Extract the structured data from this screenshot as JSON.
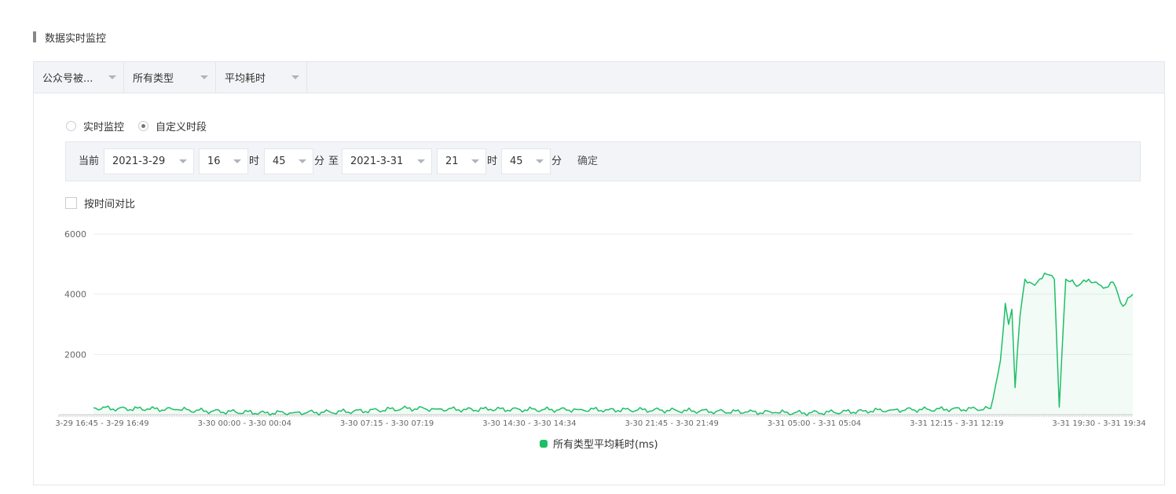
{
  "section_title": "数据实时监控",
  "filters": [
    {
      "label": "公众号被..."
    },
    {
      "label": "所有类型"
    },
    {
      "label": "平均耗时"
    }
  ],
  "mode": {
    "options": [
      {
        "label": "实时监控",
        "checked": false
      },
      {
        "label": "自定义时段",
        "checked": true
      }
    ]
  },
  "range": {
    "current_label": "当前",
    "start_date": "2021-3-29",
    "start_hour": "16",
    "hour_unit": "时",
    "start_minute": "45",
    "minute_unit": "分",
    "to_label": "至",
    "end_date": "2021-3-31",
    "end_hour": "21",
    "end_minute": "45",
    "confirm_label": "确定"
  },
  "compare": {
    "label": "按时间对比",
    "checked": false
  },
  "colors": {
    "series": "#1dbf66",
    "grid": "#eeeeee",
    "axis_text": "#666666"
  },
  "chart_data": {
    "type": "area",
    "ylim": [
      0,
      6000
    ],
    "yticks": [
      "6000",
      "4000",
      "2000"
    ],
    "x_ticks": [
      "3-29 16:45 - 3-29 16:49",
      "3-30 00:00 - 3-30 00:04",
      "3-30 07:15 - 3-30 07:19",
      "3-30 14:30 - 3-30 14:34",
      "3-30 21:45 - 3-30 21:49",
      "3-31 05:00 - 3-31 05:04",
      "3-31 12:15 - 3-31 12:19",
      "3-31 19:30 - 3-31 19:34"
    ],
    "series": [
      {
        "name": "所有类型平均耗时(ms)",
        "points": [
          [
            "3-29 16:45",
            230
          ],
          [
            "3-29 18:00",
            200
          ],
          [
            "3-29 19:30",
            190
          ],
          [
            "3-29 21:00",
            170
          ],
          [
            "3-29 22:30",
            120
          ],
          [
            "3-30 00:00",
            90
          ],
          [
            "3-30 01:30",
            60
          ],
          [
            "3-30 03:00",
            70
          ],
          [
            "3-30 04:30",
            80
          ],
          [
            "3-30 06:00",
            110
          ],
          [
            "3-30 07:15",
            150
          ],
          [
            "3-30 08:45",
            210
          ],
          [
            "3-30 10:15",
            190
          ],
          [
            "3-30 11:45",
            170
          ],
          [
            "3-30 13:00",
            180
          ],
          [
            "3-30 14:30",
            170
          ],
          [
            "3-30 16:00",
            165
          ],
          [
            "3-30 17:30",
            170
          ],
          [
            "3-30 19:00",
            160
          ],
          [
            "3-30 20:30",
            155
          ],
          [
            "3-30 21:45",
            150
          ],
          [
            "3-30 23:00",
            130
          ],
          [
            "3-31 00:30",
            110
          ],
          [
            "3-31 02:00",
            90
          ],
          [
            "3-31 03:30",
            70
          ],
          [
            "3-31 05:00",
            60
          ],
          [
            "3-31 06:30",
            80
          ],
          [
            "3-31 08:00",
            120
          ],
          [
            "3-31 09:30",
            160
          ],
          [
            "3-31 11:00",
            170
          ],
          [
            "3-31 12:15",
            180
          ],
          [
            "3-31 13:45",
            190
          ],
          [
            "3-31 14:30",
            200
          ],
          [
            "3-31 15:00",
            1800
          ],
          [
            "3-31 15:10",
            3000
          ],
          [
            "3-31 15:15",
            3700
          ],
          [
            "3-31 15:25",
            3000
          ],
          [
            "3-31 15:35",
            3500
          ],
          [
            "3-31 15:45",
            900
          ],
          [
            "3-31 16:00",
            3300
          ],
          [
            "3-31 16:15",
            4500
          ],
          [
            "3-31 16:45",
            4300
          ],
          [
            "3-31 17:15",
            4700
          ],
          [
            "3-31 17:45",
            4500
          ],
          [
            "3-31 18:00",
            250
          ],
          [
            "3-31 18:20",
            4500
          ],
          [
            "3-31 19:00",
            4300
          ],
          [
            "3-31 19:30",
            4500
          ],
          [
            "3-31 20:15",
            4200
          ],
          [
            "3-31 20:45",
            4400
          ],
          [
            "3-31 21:15",
            3600
          ],
          [
            "3-31 21:45",
            4000
          ]
        ]
      }
    ]
  }
}
